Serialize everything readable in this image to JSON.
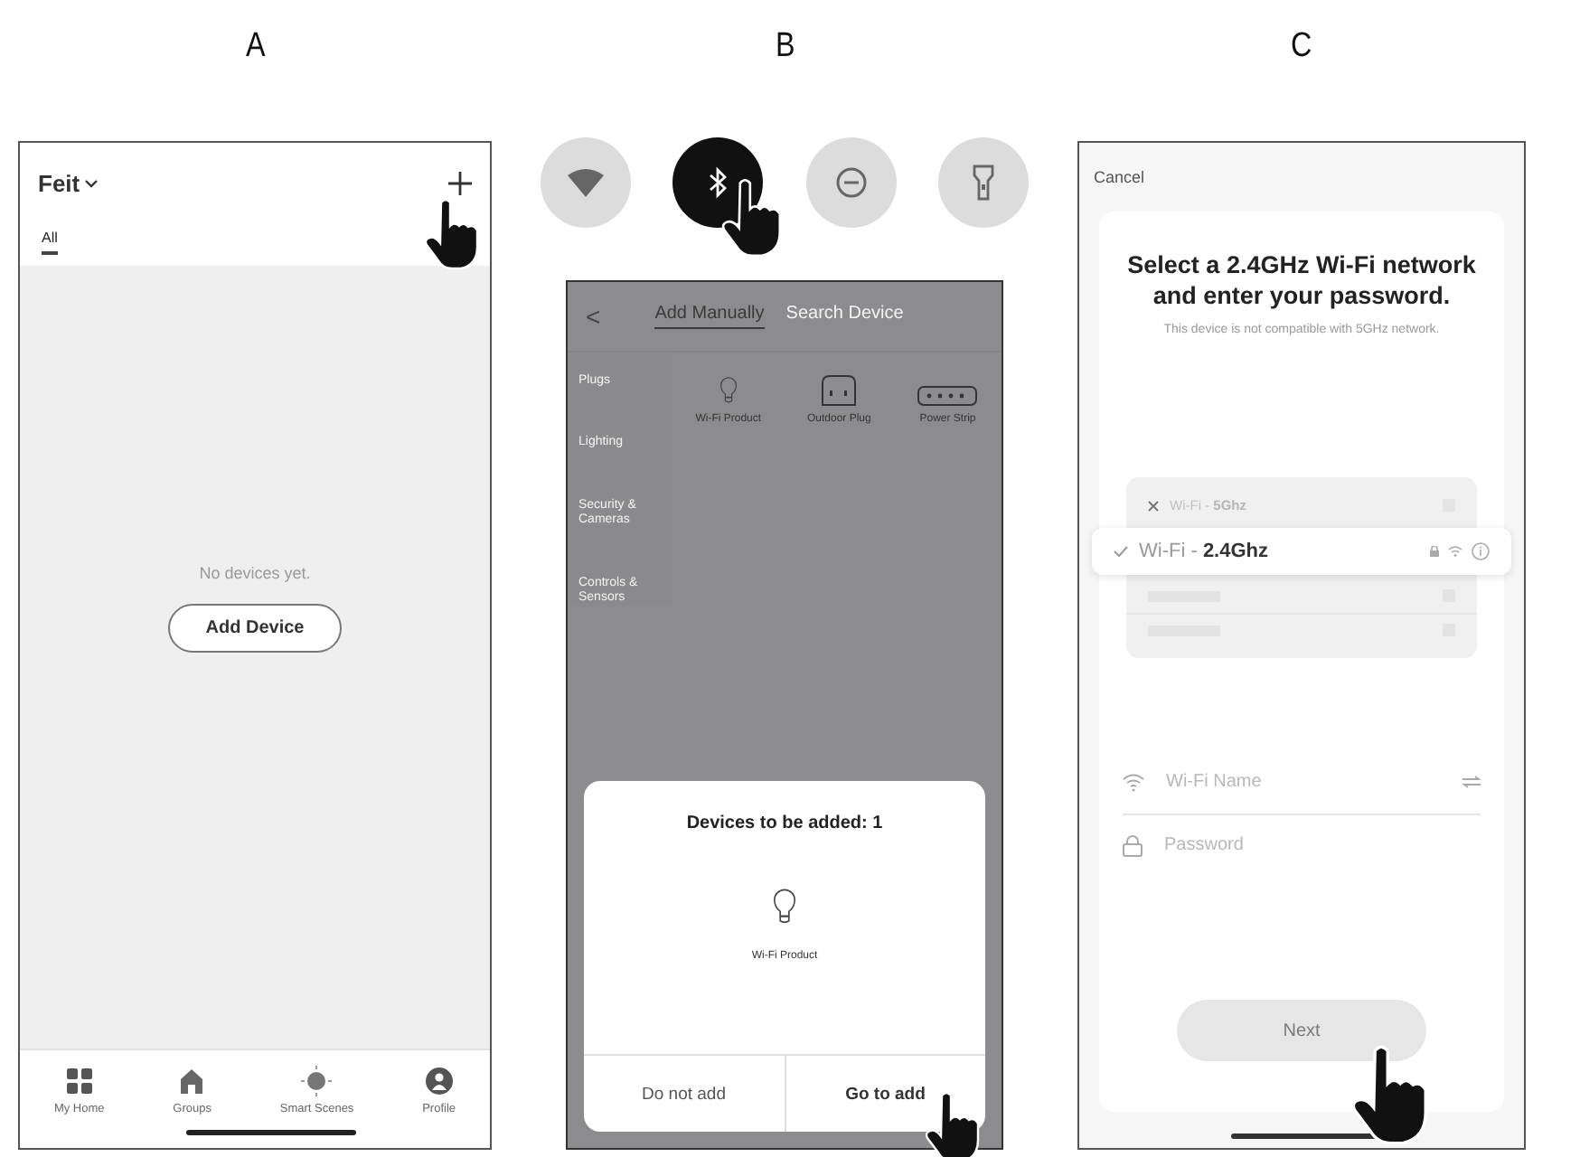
{
  "steps": [
    {
      "label": "A"
    },
    {
      "label": "B"
    },
    {
      "label": "C"
    }
  ],
  "home_screen": {
    "home_name": "Feit",
    "tabs": [
      {
        "label": "All",
        "selected": true
      }
    ],
    "empty_text": "No devices yet.",
    "add_button": "Add Device",
    "nav": [
      {
        "kind": "grid",
        "label": "My Home"
      },
      {
        "kind": "house",
        "label": "Groups"
      },
      {
        "kind": "sun",
        "label": "Smart Scenes"
      },
      {
        "kind": "person",
        "label": "Profile"
      }
    ]
  },
  "quick_toggles": [
    {
      "kind": "wifi",
      "on": false
    },
    {
      "kind": "bluetooth",
      "on": true
    },
    {
      "kind": "minus",
      "on": false
    },
    {
      "kind": "flashlight",
      "on": false
    }
  ],
  "add_device_screen": {
    "back": "<",
    "tabs": [
      {
        "label": "Add Manually",
        "selected": true
      },
      {
        "label": "Search Device",
        "selected": false
      }
    ],
    "categories": [
      {
        "label": "Plugs"
      },
      {
        "label": "Lighting"
      },
      {
        "label": "Security & Cameras"
      },
      {
        "label": "Controls & Sensors"
      }
    ],
    "products": [
      {
        "kind": "bulb",
        "label": "Wi-Fi Product"
      },
      {
        "kind": "outdoor-plug",
        "label": "Outdoor Plug"
      },
      {
        "kind": "power-strip",
        "label": "Power Strip"
      }
    ],
    "dialog": {
      "title": "Devices to be added: 1",
      "device": {
        "kind": "bulb",
        "label": "Wi-Fi Product"
      },
      "buttons": [
        {
          "label": "Do not add",
          "kind": "secondary"
        },
        {
          "label": "Go to add",
          "kind": "primary"
        }
      ]
    }
  },
  "wifi_screen": {
    "cancel": "Cancel",
    "title": "Select a 2.4GHz Wi-Fi network and enter your password.",
    "note": "This device is not compatible with 5GHz network.",
    "networks": [
      {
        "name": "Wi-Fi - **5Ghz**",
        "selected": false
      },
      {
        "name": "Wi-Fi - **2.4Ghz**",
        "selected": true
      }
    ],
    "wifi_name": {
      "placeholder": "Wi-Fi Name"
    },
    "password": {
      "placeholder": "Password"
    },
    "next_button": {
      "label": "Next",
      "disabled": true
    }
  }
}
